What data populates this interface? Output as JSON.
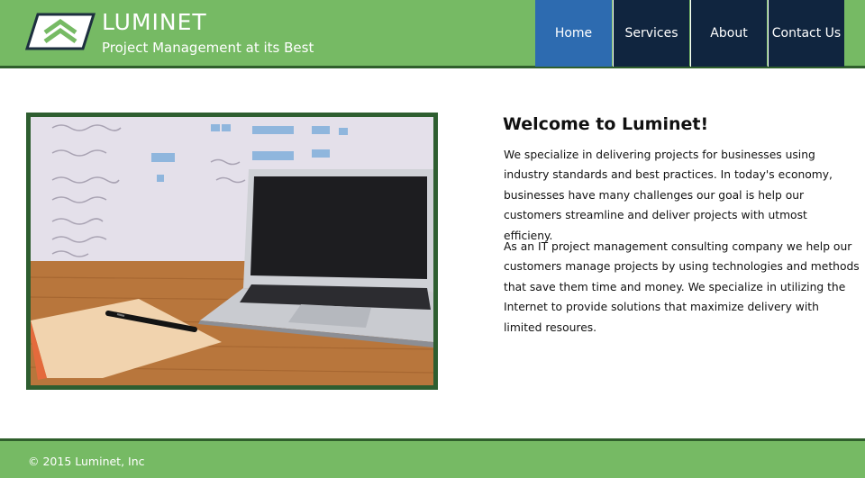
{
  "header": {
    "title": "LUMINET",
    "tagline": "Project Management at its Best",
    "logo_icon": "double-chevron-up-icon"
  },
  "nav": {
    "items": [
      {
        "label": "Home",
        "active": true
      },
      {
        "label": "Services",
        "active": false
      },
      {
        "label": "About",
        "active": false
      },
      {
        "label": "Contact Us",
        "active": false
      }
    ]
  },
  "main": {
    "heading": "Welcome to Luminet!",
    "paragraph1": "We specialize in delivering projects for businesses using industry standards and best practices. In today's economy, businesses have many challenges our goal is help our customers streamline and deliver projects with utmost efficieny.",
    "paragraph2": "As an IT project management consulting company we help our customers manage projects by using technologies and methods that save them time and money. We specialize in utilizing the Internet to provide solutions that maximize delivery with limited resoures."
  },
  "footer": {
    "copyright": "© 2015 Luminet, Inc"
  },
  "colors": {
    "header_green": "#76ba64",
    "dark_green": "#2f5f2c",
    "nav_dark": "#10253f",
    "nav_active": "#2d6bb0"
  }
}
